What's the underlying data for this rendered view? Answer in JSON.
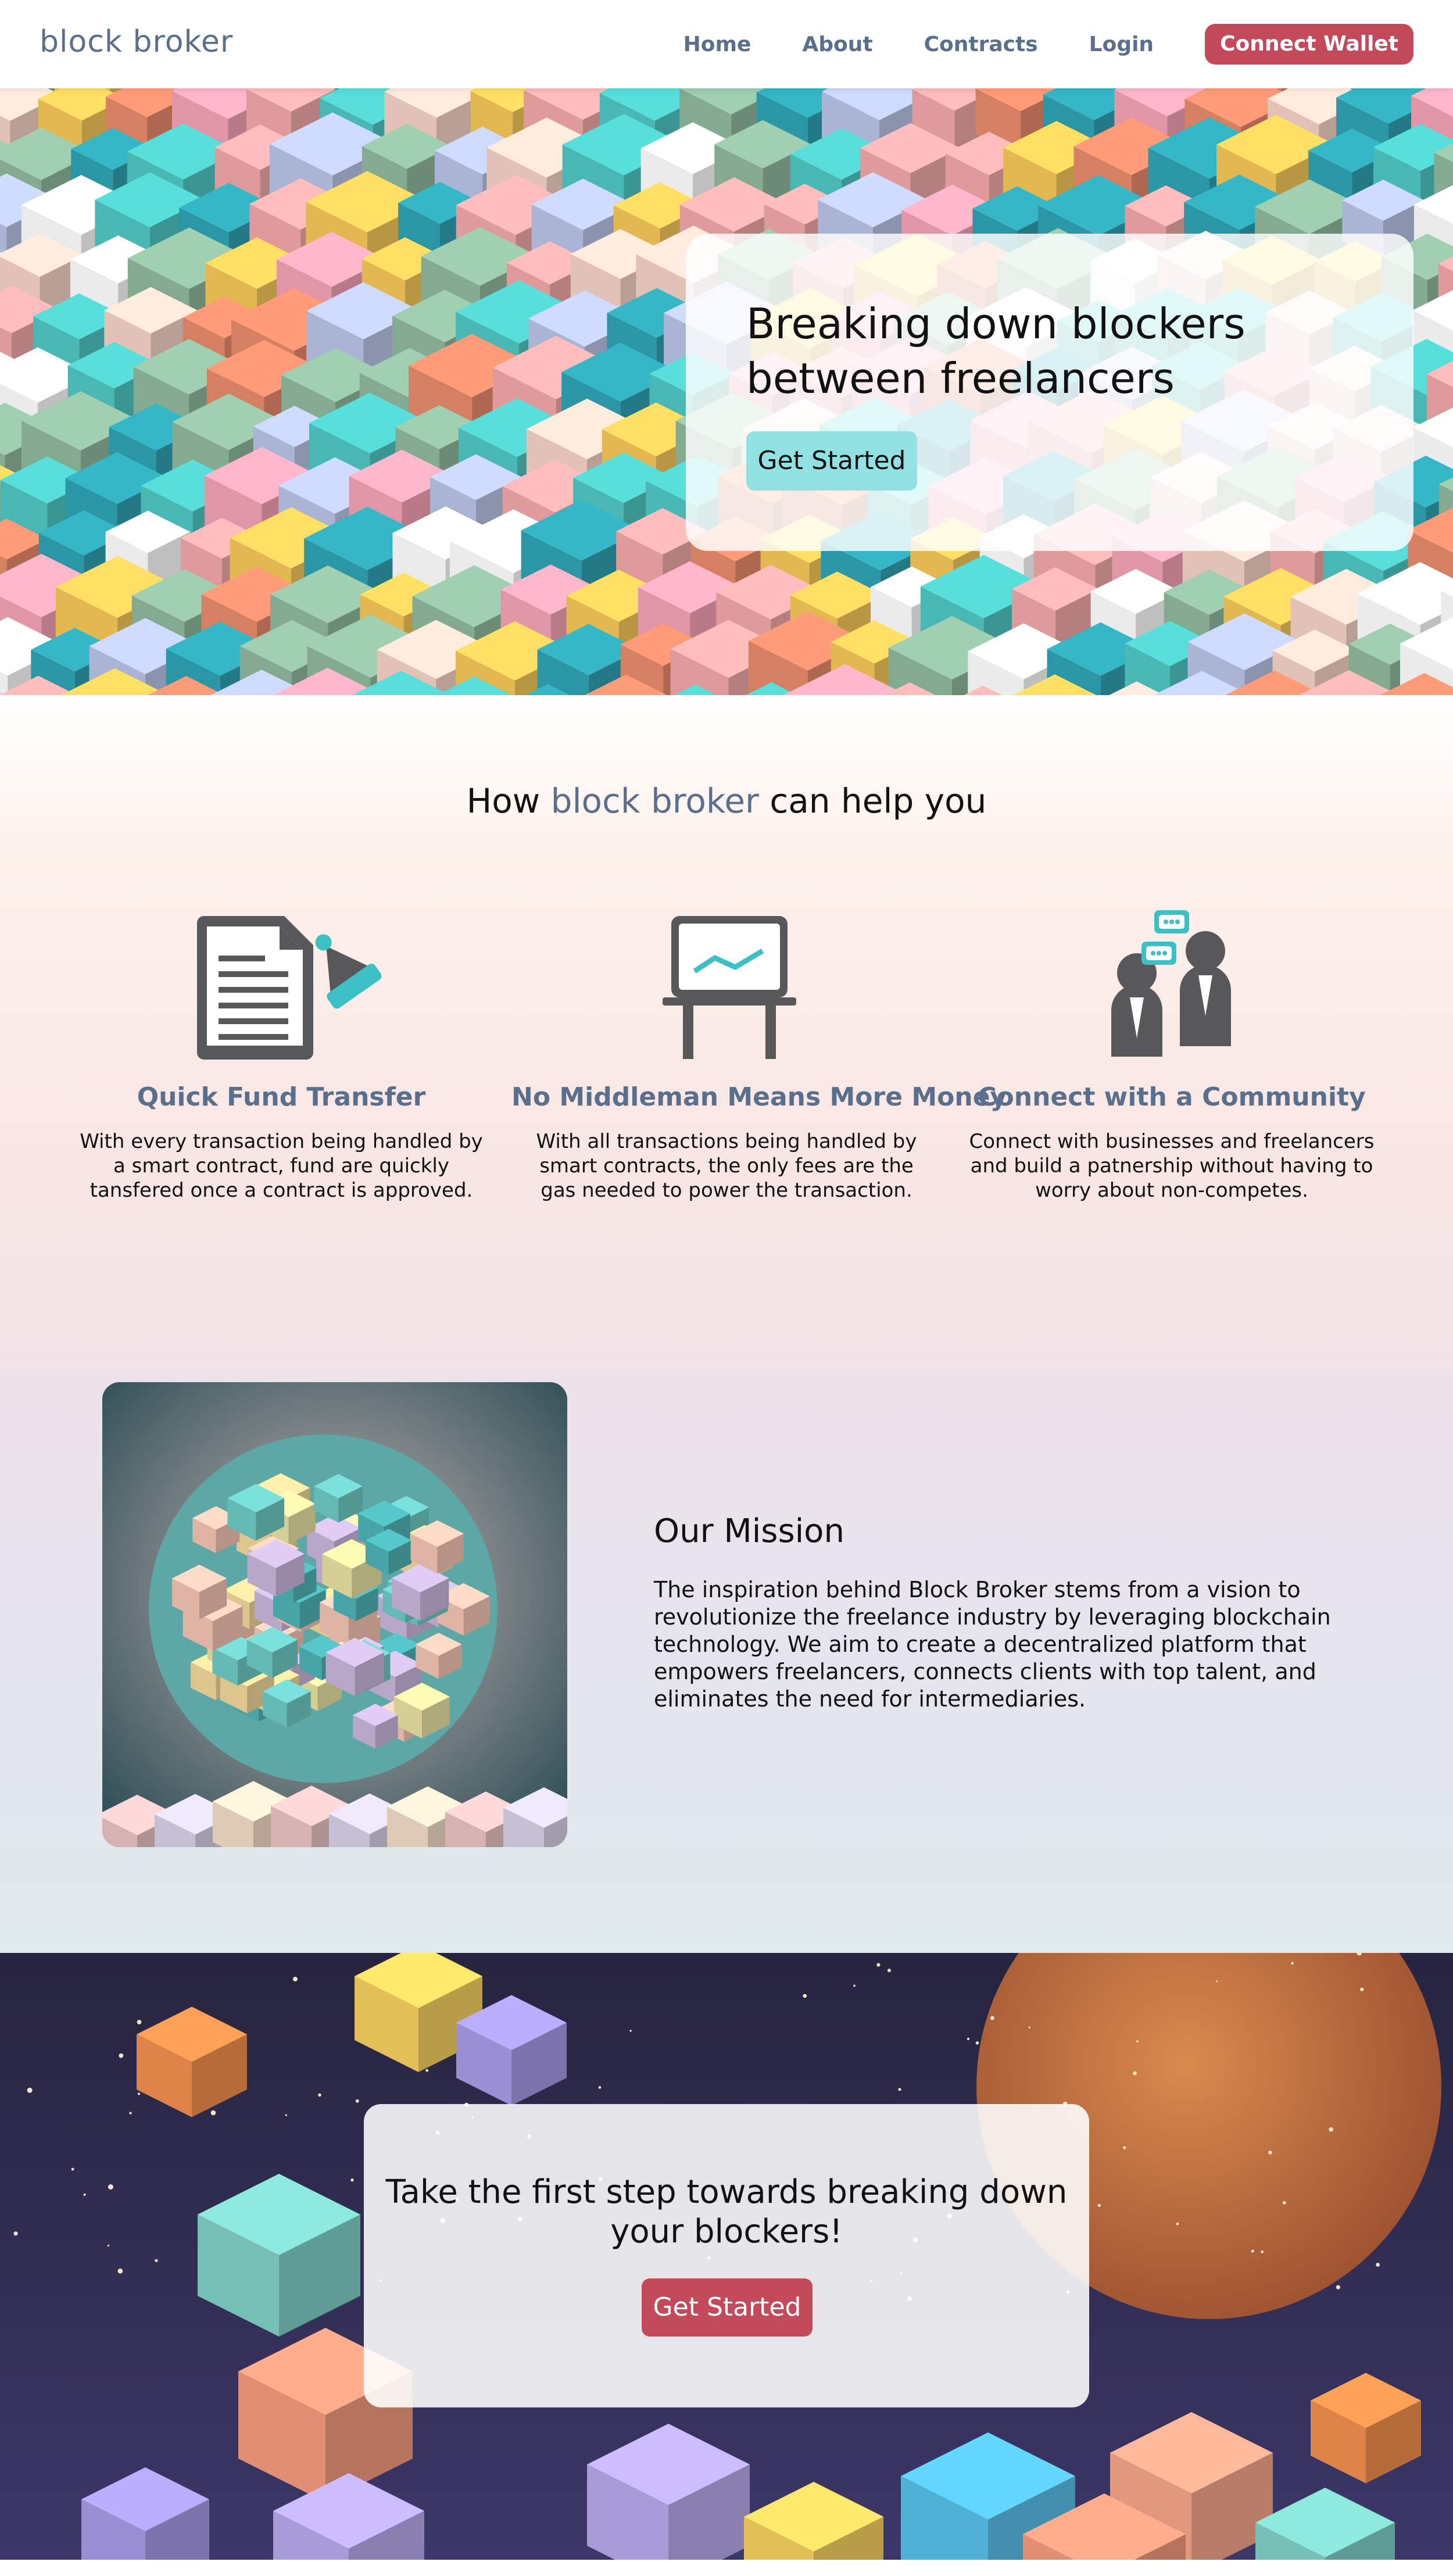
{
  "nav": {
    "brand": "block  broker",
    "links": [
      "Home",
      "About",
      "Contracts",
      "Login"
    ],
    "wallet_button": "Connect Wallet"
  },
  "hero": {
    "title": "Breaking down blockers between freelancers",
    "button": "Get Started"
  },
  "features": {
    "title_prefix": "How ",
    "title_accent": "block  broker",
    "title_suffix": " can help you",
    "items": [
      {
        "icon": "document-pen-icon",
        "title": "Quick Fund Transfer",
        "desc": "With every transaction being handled by a smart contract, fund are quickly tansfered once a contract is approved."
      },
      {
        "icon": "presentation-board-icon",
        "title": "No Middleman Means More Money",
        "desc": "With all transactions being handled by smart contracts, the only fees are the gas needed to power the transaction."
      },
      {
        "icon": "people-chat-icon",
        "title": "Connect with a Community",
        "desc": "Connect with businesses and freelancers and build a patnership without having to worry about non-competes."
      }
    ]
  },
  "mission": {
    "heading": "Our Mission",
    "text": "The inspiration behind Block Broker stems from a vision to revolutionize the freelance industry by leveraging blockchain technology. We aim to create a decentralized platform that empowers freelancers, connects clients with top talent, and eliminates the need for intermediaries."
  },
  "cta": {
    "title": "Take the first step towards breaking down your blockers!",
    "button": "Get Started"
  },
  "colors": {
    "brand_blue": "#5a6f8c",
    "accent_red": "#c24a5b",
    "accent_teal": "#92e1e2"
  }
}
